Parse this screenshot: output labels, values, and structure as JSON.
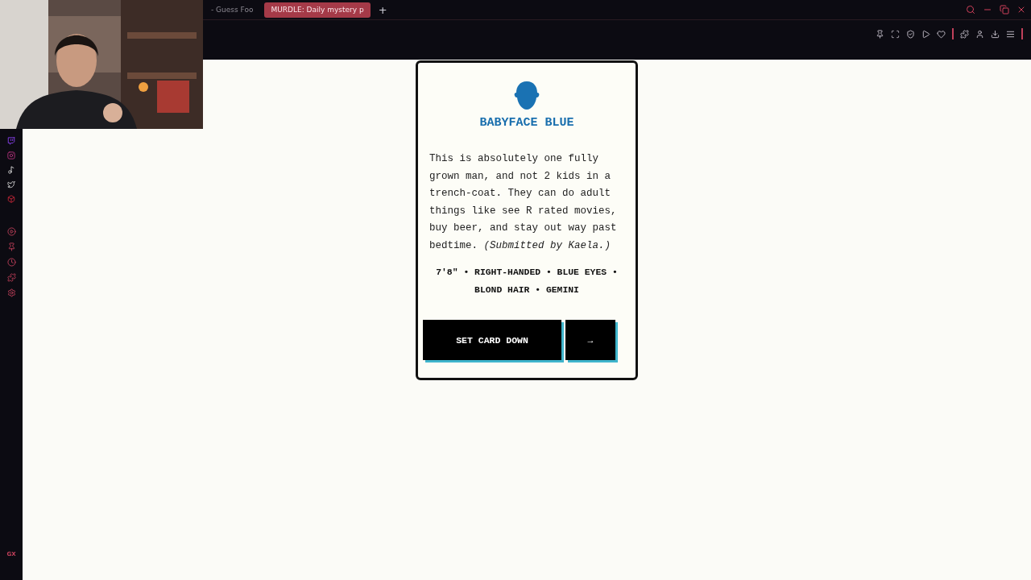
{
  "browser": {
    "tabs": [
      {
        "label": "- Guess Foo",
        "selected": false
      },
      {
        "label": "MURDLE: Daily mystery p",
        "selected": true
      }
    ],
    "new_tab": "+"
  },
  "sidebar": {
    "logo": "GX"
  },
  "card": {
    "name": "BABYFACE BLUE",
    "description": "This is absolutely one fully grown man, and not 2 kids in a trench-coat. They can do adult things like see R rated movies, buy beer, and stay out way past bedtime. *(Submitted by Kaela.)*",
    "traits": "7'8\" • RIGHT-HANDED • BLUE EYES • BLOND HAIR • GEMINI",
    "buttons": [
      {
        "kind": "wide",
        "label": "SET CARD DOWN"
      },
      {
        "kind": "narrow",
        "label": "→"
      }
    ]
  }
}
